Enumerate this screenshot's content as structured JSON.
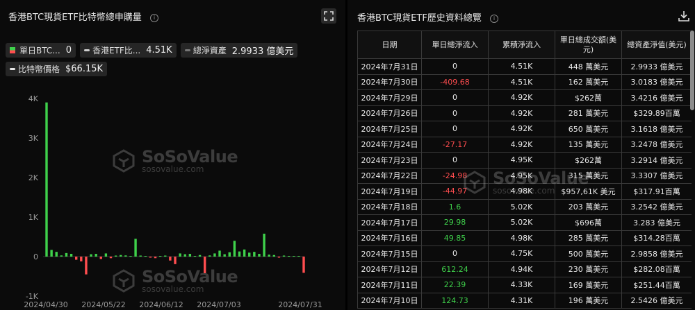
{
  "left_panel": {
    "title": "香港BTC現貨ETF比特幣總申購量",
    "info_icon": "info-icon",
    "expand_icon": "expand-icon",
    "legend": {
      "daily_label": "單日BTC...",
      "daily_value": "0",
      "holdings_label": "香港ETF比...",
      "holdings_value": "4.51K",
      "assets_label": "總淨資產",
      "assets_value": "2.9933 億美元",
      "price_label": "比特幣價格",
      "price_value": "$66.15K"
    }
  },
  "watermark": {
    "brand": "SoSoValue",
    "site": "sosovalue.com"
  },
  "chart_data": {
    "type": "bar",
    "title": "香港BTC現貨ETF比特幣總申購量",
    "ylim": [
      -1000,
      4000
    ],
    "yticks": [
      "4K",
      "3K",
      "2K",
      "1K",
      "0",
      "-1K"
    ],
    "xticks": [
      "2024/04/30",
      "2024/05/22",
      "2024/06/12",
      "2024/07/03",
      "2024/07/31"
    ],
    "colors": {
      "positive": "#3fd14b",
      "negative": "#ff4d4f"
    },
    "series": [
      {
        "values": [
          3900,
          170,
          120,
          30,
          90,
          70,
          -80,
          -120,
          -450,
          60,
          70,
          -60,
          80,
          -40,
          20,
          40,
          30,
          0,
          450,
          10,
          0,
          -20,
          -40,
          0,
          20,
          -100,
          -190,
          80,
          60,
          70,
          0,
          40,
          -420,
          30,
          80,
          150,
          60,
          110,
          400,
          130,
          180,
          100,
          120,
          70,
          580,
          50,
          40,
          -20,
          10,
          0,
          0,
          0,
          -410
        ]
      }
    ]
  },
  "right_panel": {
    "title": "香港BTC現貨ETF歷史資料總覽",
    "info_icon": "info-icon",
    "download_icon": "download-icon",
    "columns": [
      "日期",
      "單日總淨流入",
      "累積淨流入",
      "單日總成交額(美元)",
      "總資產淨值(美元)"
    ],
    "rows": [
      [
        "2024年7月31日",
        "0",
        "4.51K",
        "448 萬美元",
        "2.9933 億美元"
      ],
      [
        "2024年7月30日",
        "-409.68",
        "4.51K",
        "162 萬美元",
        "3.0183 億美元"
      ],
      [
        "2024年7月29日",
        "0",
        "4.92K",
        "$262萬",
        "3.4216 億美元"
      ],
      [
        "2024年7月26日",
        "0",
        "4.92K",
        "281 萬美元",
        "$329.89百萬"
      ],
      [
        "2024年7月25日",
        "0",
        "4.92K",
        "650 萬美元",
        "3.1618 億美元"
      ],
      [
        "2024年7月24日",
        "-27.17",
        "4.92K",
        "135 萬美元",
        "3.2478 億美元"
      ],
      [
        "2024年7月23日",
        "0",
        "4.95K",
        "$262萬",
        "3.2914 億美元"
      ],
      [
        "2024年7月22日",
        "-24.98",
        "4.95K",
        "315 萬美元",
        "3.3307 億美元"
      ],
      [
        "2024年7月19日",
        "-44.97",
        "4.98K",
        "$957,61K 美元",
        "$317.91百萬"
      ],
      [
        "2024年7月18日",
        "1.6",
        "5.02K",
        "203 萬美元",
        "3.2542 億美元"
      ],
      [
        "2024年7月17日",
        "29.98",
        "5.02K",
        "$696萬",
        "3.283 億美元"
      ],
      [
        "2024年7月16日",
        "49.85",
        "4.98K",
        "285 萬美元",
        "$314.28百萬"
      ],
      [
        "2024年7月15日",
        "0",
        "4.75K",
        "500 萬美元",
        "2.9858 億美元"
      ],
      [
        "2024年7月12日",
        "612.24",
        "4.94K",
        "230 萬美元",
        "$282.08百萬"
      ],
      [
        "2024年7月11日",
        "22.39",
        "4.33K",
        "169 萬美元",
        "$251.44百萬"
      ],
      [
        "2024年7月10日",
        "124.73",
        "4.31K",
        "196 萬美元",
        "2.5426 億美元"
      ]
    ]
  }
}
